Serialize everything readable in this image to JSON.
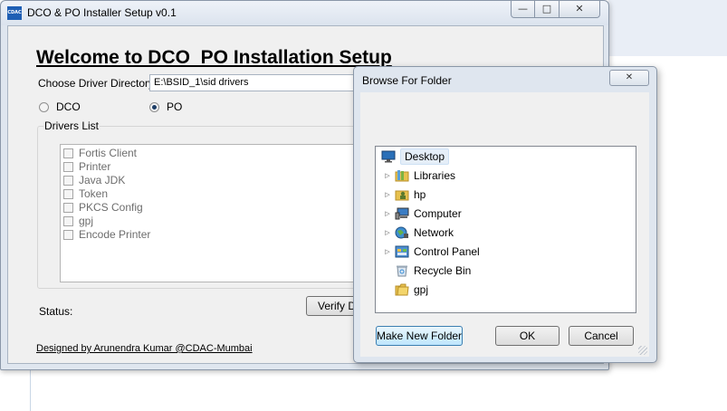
{
  "main_window": {
    "title": "DCO & PO Installer Setup v0.1",
    "icon_text": "CDAC",
    "welcome_title": "Welcome to DCO  PO Installation Setup",
    "dir_label": "Choose Driver Directory",
    "dir_value": "E:\\BSID_1\\sid drivers",
    "radio_dco": "DCO",
    "radio_po": "PO",
    "selected_mode": "PO",
    "drivers_group_label": "Drivers List",
    "drivers": [
      "Fortis Client",
      "Printer",
      "Java JDK",
      "Token",
      "PKCS Config",
      "gpj",
      "Encode Printer"
    ],
    "status_label": "Status:",
    "verify_button": "Verify Dri",
    "credit": "Designed by Arunendra Kumar @CDAC-Mumbai"
  },
  "dialog": {
    "title": "Browse For Folder",
    "tree": [
      {
        "label": "Desktop",
        "icon": "desktop-icon",
        "expandable": false,
        "selected": true,
        "indent": 0
      },
      {
        "label": "Libraries",
        "icon": "libraries-icon",
        "expandable": true,
        "selected": false,
        "indent": 1
      },
      {
        "label": "hp",
        "icon": "user-folder-icon",
        "expandable": true,
        "selected": false,
        "indent": 1
      },
      {
        "label": "Computer",
        "icon": "computer-icon",
        "expandable": true,
        "selected": false,
        "indent": 1
      },
      {
        "label": "Network",
        "icon": "network-icon",
        "expandable": true,
        "selected": false,
        "indent": 1
      },
      {
        "label": "Control Panel",
        "icon": "control-panel-icon",
        "expandable": true,
        "selected": false,
        "indent": 1
      },
      {
        "label": "Recycle Bin",
        "icon": "recycle-bin-icon",
        "expandable": false,
        "selected": false,
        "indent": 1
      },
      {
        "label": "gpj",
        "icon": "folder-icon",
        "expandable": false,
        "selected": false,
        "indent": 1
      }
    ],
    "make_new_folder_button": "Make New Folder",
    "ok_button": "OK",
    "cancel_button": "Cancel"
  },
  "colors": {
    "window_frame": "#dfe6ef",
    "client_bg": "#f0f0f0",
    "selection": "#e5eef8",
    "focus_button": "#bee6fd"
  }
}
